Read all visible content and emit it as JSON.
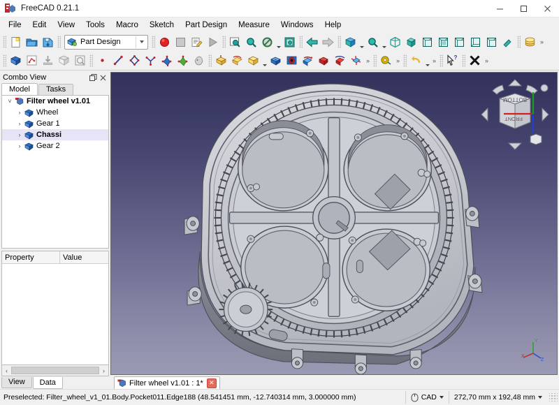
{
  "window": {
    "title": "FreeCAD 0.21.1",
    "app_icon": "freecad-logo-icon",
    "minimize": "─",
    "maximize": "☐",
    "close": "✕"
  },
  "menubar": {
    "items": [
      {
        "label": "File"
      },
      {
        "label": "Edit"
      },
      {
        "label": "View"
      },
      {
        "label": "Tools"
      },
      {
        "label": "Macro"
      },
      {
        "label": "Sketch"
      },
      {
        "label": "Part Design"
      },
      {
        "label": "Measure"
      },
      {
        "label": "Windows"
      },
      {
        "label": "Help"
      }
    ]
  },
  "toolbars": {
    "workbench_selector": {
      "value": "Part Design",
      "icon": "part-design-workbench-icon"
    },
    "file": [
      {
        "name": "new-document-icon"
      },
      {
        "name": "open-document-icon"
      },
      {
        "name": "save-document-icon"
      }
    ],
    "macro": [
      {
        "name": "macro-record-icon"
      },
      {
        "name": "macro-stop-icon"
      },
      {
        "name": "macro-edit-icon"
      },
      {
        "name": "macro-execute-icon"
      }
    ],
    "view_controls": [
      {
        "name": "fit-all-icon"
      },
      {
        "name": "fit-selection-icon"
      },
      {
        "name": "draw-style-icon"
      },
      {
        "name": "clipping-plane-icon"
      },
      {
        "name": "nav-back-icon"
      },
      {
        "name": "nav-forward-icon"
      },
      {
        "name": "isometric-view-icon"
      },
      {
        "name": "zoom-box-icon"
      }
    ],
    "standard_views": [
      {
        "name": "axonometric-view-icon"
      },
      {
        "name": "front-view-icon"
      },
      {
        "name": "top-view-icon"
      },
      {
        "name": "right-view-icon"
      },
      {
        "name": "rear-view-icon"
      },
      {
        "name": "bottom-view-icon"
      },
      {
        "name": "left-view-icon"
      },
      {
        "name": "measure-icon"
      },
      {
        "name": "appearance-icon"
      }
    ],
    "part_design_row": [
      {
        "name": "create-body-icon"
      },
      {
        "name": "create-sketch-icon"
      },
      {
        "name": "attach-sketch-icon"
      },
      {
        "name": "create-datum-icon"
      },
      {
        "name": "validate-sketch-icon"
      }
    ],
    "sketcher_geometry": [
      {
        "name": "create-point-icon"
      },
      {
        "name": "create-line-icon"
      },
      {
        "name": "create-polyline-icon"
      },
      {
        "name": "create-arc-icon"
      },
      {
        "name": "create-fillet-icon"
      },
      {
        "name": "trim-edge-icon"
      },
      {
        "name": "external-geometry-icon"
      }
    ],
    "additive_tools": [
      {
        "name": "pad-icon"
      },
      {
        "name": "revolution-icon"
      },
      {
        "name": "additive-loft-icon"
      },
      {
        "name": "additive-pipe-icon"
      },
      {
        "name": "additive-primitive-icon"
      }
    ],
    "subtractive_tools": [
      {
        "name": "pocket-icon"
      },
      {
        "name": "hole-icon"
      },
      {
        "name": "groove-icon"
      },
      {
        "name": "subtractive-loft-icon"
      },
      {
        "name": "subtractive-pipe-icon"
      },
      {
        "name": "subtractive-primitive-icon"
      }
    ],
    "misc": [
      {
        "name": "measure-tape-icon"
      },
      {
        "name": "undo-icon"
      },
      {
        "name": "whats-this-icon"
      },
      {
        "name": "close-document-icon"
      }
    ],
    "overflow_glyph": "»"
  },
  "combo_view": {
    "title": "Combo View",
    "float_icon": "undock-panel-icon",
    "close_icon": "close-panel-icon",
    "tabs": [
      {
        "label": "Model",
        "active": true
      },
      {
        "label": "Tasks",
        "active": false
      }
    ],
    "tree": [
      {
        "label": "Filter wheel v1.01",
        "icon": "document-icon",
        "depth": 0,
        "expanded": true,
        "bold": true,
        "selected": false
      },
      {
        "label": "Wheel",
        "icon": "body-icon",
        "depth": 1,
        "expanded": false,
        "bold": false,
        "selected": false
      },
      {
        "label": "Gear 1",
        "icon": "body-icon",
        "depth": 1,
        "expanded": false,
        "bold": false,
        "selected": false
      },
      {
        "label": "Chassi",
        "icon": "body-icon",
        "depth": 1,
        "expanded": false,
        "bold": true,
        "selected": true
      },
      {
        "label": "Gear 2",
        "icon": "body-icon",
        "depth": 1,
        "expanded": false,
        "bold": false,
        "selected": false
      }
    ],
    "expand_collapsed_glyph": "›",
    "expand_expanded_glyph": "˅",
    "property_editor": {
      "columns": [
        "Property",
        "Value"
      ],
      "rows": []
    },
    "bottom_tabs": [
      {
        "label": "View",
        "active": false
      },
      {
        "label": "Data",
        "active": true
      }
    ],
    "scroll_left_glyph": "‹",
    "scroll_right_glyph": "›"
  },
  "view3d": {
    "background_top": "#32325c",
    "background_bottom": "#9a9ab4",
    "model_name": "filter-wheel-assembly",
    "nav_cube": {
      "top_face_label": "BOTTOM",
      "front_face_label": "FRONT"
    },
    "axis_labels": {
      "x": "X",
      "y": "Y",
      "z": "Z"
    }
  },
  "document_tabs": [
    {
      "label": "Filter wheel v1.01 : 1*",
      "icon": "freecad-document-icon",
      "close": "✕",
      "active": true
    }
  ],
  "status_bar": {
    "message": "Preselected: Filter_wheel_v1_01.Body.Pocket011.Edge188 (48.541451 mm, -12.740314 mm, 3.000000 mm)",
    "navigation_mode": "CAD",
    "navigation_icon": "mouse-icon",
    "dimensions": "272,70 mm x 192,48 mm"
  }
}
